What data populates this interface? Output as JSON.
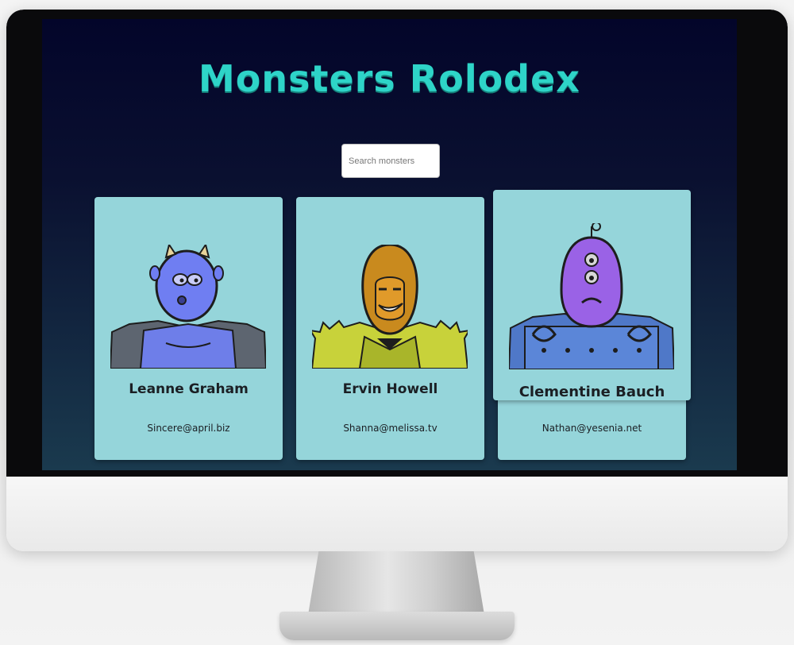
{
  "app": {
    "title": "Monsters Rolodex"
  },
  "search": {
    "placeholder": "Search monsters",
    "value": ""
  },
  "monsters": [
    {
      "name": "Leanne Graham",
      "email": "Sincere@april.biz",
      "color": "#6f7ef2"
    },
    {
      "name": "Ervin Howell",
      "email": "Shanna@melissa.tv",
      "color": "#c98a1e"
    },
    {
      "name": "Clementine Bauch",
      "email": "Nathan@yesenia.net",
      "color": "#9a62e6"
    }
  ],
  "colors": {
    "title": "#2ed4c8",
    "card": "#95d5da",
    "background_top": "#03052a",
    "background_bottom": "#1a3a4e"
  }
}
